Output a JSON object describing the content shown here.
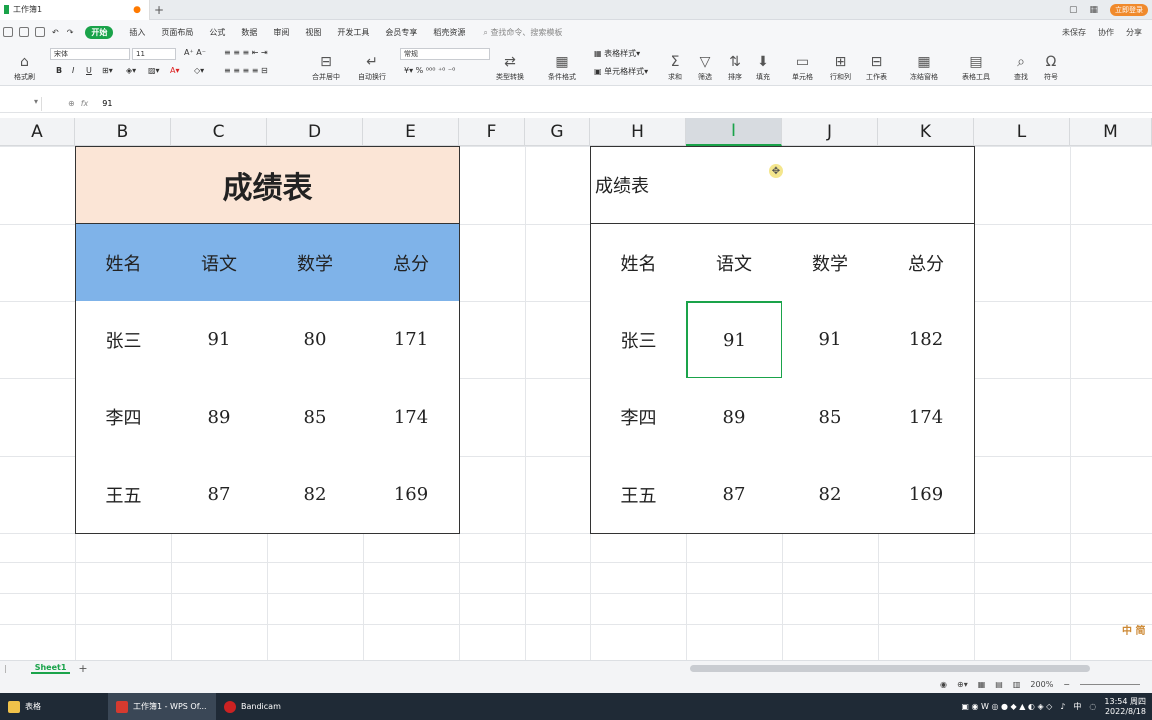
{
  "titlebar": {
    "doc_tab": "工作簿1",
    "plus": "+",
    "login": "立即登录"
  },
  "menubar": {
    "items": [
      "开始",
      "插入",
      "页面布局",
      "公式",
      "数据",
      "审阅",
      "视图",
      "开发工具",
      "会员专享",
      "稻壳资源"
    ],
    "search": "查找命令、搜索模板",
    "right": [
      "未保存",
      "协作",
      "分享"
    ]
  },
  "ribbon": {
    "format_painter": "格式刷",
    "font_name": "宋体",
    "font_size": "11",
    "merge_center": "合并居中",
    "wrap": "自动换行",
    "number_format": "常规",
    "type_convert": "类型转换",
    "cond_format": "条件格式",
    "table_style": "表格样式",
    "cell_style": "单元格样式",
    "sum": "求和",
    "filter": "筛选",
    "sort": "排序",
    "fill": "填充",
    "cell": "单元格",
    "rowcol": "行和列",
    "worksheet": "工作表",
    "freeze": "冻结窗格",
    "table_tools": "表格工具",
    "find": "查找",
    "symbol": "符号"
  },
  "formula": {
    "fx": "fx",
    "value": "91"
  },
  "columns": [
    "A",
    "B",
    "C",
    "D",
    "E",
    "F",
    "G",
    "H",
    "I",
    "J",
    "K",
    "L",
    "M"
  ],
  "left_table": {
    "title": "成绩表",
    "headers": [
      "姓名",
      "语文",
      "数学",
      "总分"
    ],
    "rows": [
      [
        "张三",
        "91",
        "80",
        "171"
      ],
      [
        "李四",
        "89",
        "85",
        "174"
      ],
      [
        "王五",
        "87",
        "82",
        "169"
      ]
    ]
  },
  "right_table": {
    "title": "成绩表",
    "headers": [
      "姓名",
      "语文",
      "数学",
      "总分"
    ],
    "rows": [
      [
        "张三",
        "91",
        "91",
        "182"
      ],
      [
        "李四",
        "89",
        "85",
        "174"
      ],
      [
        "王五",
        "87",
        "82",
        "169"
      ]
    ]
  },
  "sheet": {
    "tab": "Sheet1",
    "add": "+"
  },
  "status": {
    "zoom": "200%"
  },
  "taskbar": {
    "items": [
      "表格",
      "工作簿1 - WPS Of...",
      "Bandicam"
    ],
    "ime": "中",
    "time": "13:54 周四",
    "date": "2022/8/18"
  },
  "colors": {
    "accent": "#1aa34a",
    "title_fill": "#fbe5d6",
    "header_fill": "#7fb3e9"
  }
}
